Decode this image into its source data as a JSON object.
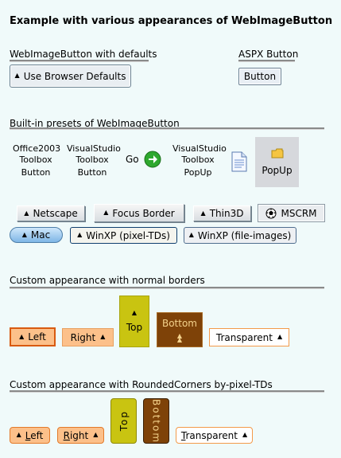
{
  "page": {
    "title": "Example with various appearances of WebImageButton"
  },
  "sections": {
    "defaults": {
      "title": "WebImageButton with defaults",
      "button_label": "Use Browser Defaults"
    },
    "aspx": {
      "title": "ASPX Button",
      "button_label": "Button"
    },
    "presets": {
      "title": "Built-in presets of WebImageButton",
      "office2003": {
        "line1": "Office2003",
        "line2": "Toolbox",
        "line3": "Button"
      },
      "vs_toolbox": {
        "line1": "VisualStudio",
        "line2": "Toolbox",
        "line3": "Button"
      },
      "go_label": "Go",
      "vs_popup": {
        "line1": "VisualStudio",
        "line2": "Toolbox",
        "line3": "PopUp"
      },
      "popup_label": "PopUp",
      "netscape": "Netscape",
      "focus_border": "Focus Border",
      "thin3d": "Thin3D",
      "mscrm": "MSCRM",
      "mac": "Mac",
      "winxp_td": "WinXP (pixel-TDs)",
      "winxp_img": "WinXP (file-images)"
    },
    "custom_normal": {
      "title": "Custom appearance with normal borders",
      "left": "Left",
      "right": "Right",
      "top": "Top",
      "bottom": "Bottom",
      "transparent": "Transparent"
    },
    "custom_rounded": {
      "title": "Custom appearance with RoundedCorners by-pixel-TDs",
      "left": "Left",
      "right": "Right",
      "top": "Top",
      "bottom": "Bottom",
      "transparent": "Transparent"
    }
  },
  "icons": {
    "chevron": "chevron-up-icon",
    "go": "green-arrow-icon",
    "document": "document-icon",
    "folder": "folder-icon",
    "soccer": "soccer-ball-icon"
  },
  "colors": {
    "background": "#f0fafa",
    "accent_orange": "#fcc08a",
    "olive": "#c9c411",
    "brown": "#7e4208"
  }
}
